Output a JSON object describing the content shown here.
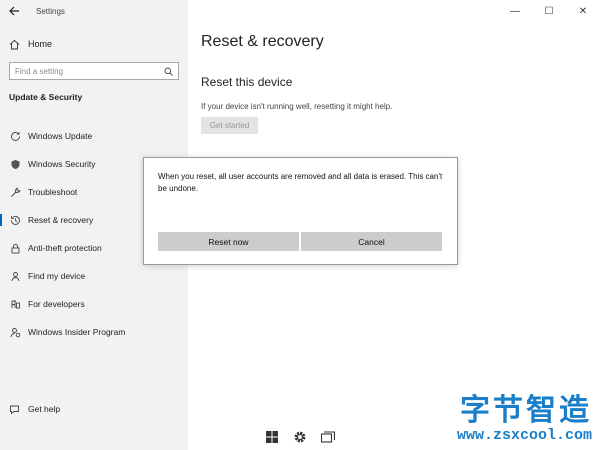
{
  "window": {
    "app_title": "Settings",
    "controls": {
      "minimize": "—",
      "maximize": "☐",
      "close": "✕"
    }
  },
  "sidebar": {
    "home_label": "Home",
    "search_placeholder": "Find a setting",
    "section_title": "Update & Security",
    "items": [
      {
        "label": "Windows Update",
        "icon": "refresh-icon"
      },
      {
        "label": "Windows Security",
        "icon": "shield-icon"
      },
      {
        "label": "Troubleshoot",
        "icon": "wrench-icon"
      },
      {
        "label": "Reset & recovery",
        "icon": "history-icon",
        "active": true
      },
      {
        "label": "Anti-theft protection",
        "icon": "lock-icon"
      },
      {
        "label": "Find my device",
        "icon": "person-pin-icon"
      },
      {
        "label": "For developers",
        "icon": "developer-icon"
      },
      {
        "label": "Windows Insider Program",
        "icon": "insider-icon"
      }
    ],
    "help_label": "Get help"
  },
  "main": {
    "page_title": "Reset & recovery",
    "sub_title": "Reset this device",
    "description": "If your device isn't running well, resetting it might help.",
    "get_started_label": "Get started"
  },
  "dialog": {
    "message": "When you reset, all user accounts are removed and all data is erased. This can't be undone.",
    "primary_label": "Reset now",
    "secondary_label": "Cancel"
  },
  "taskbar": {
    "icons": [
      "windows-start-icon",
      "settings-gear-icon",
      "task-view-icon"
    ]
  },
  "watermark": {
    "chinese": "字节智造",
    "url": "www.zsxcool.com",
    "color": "#1a7fc8"
  }
}
